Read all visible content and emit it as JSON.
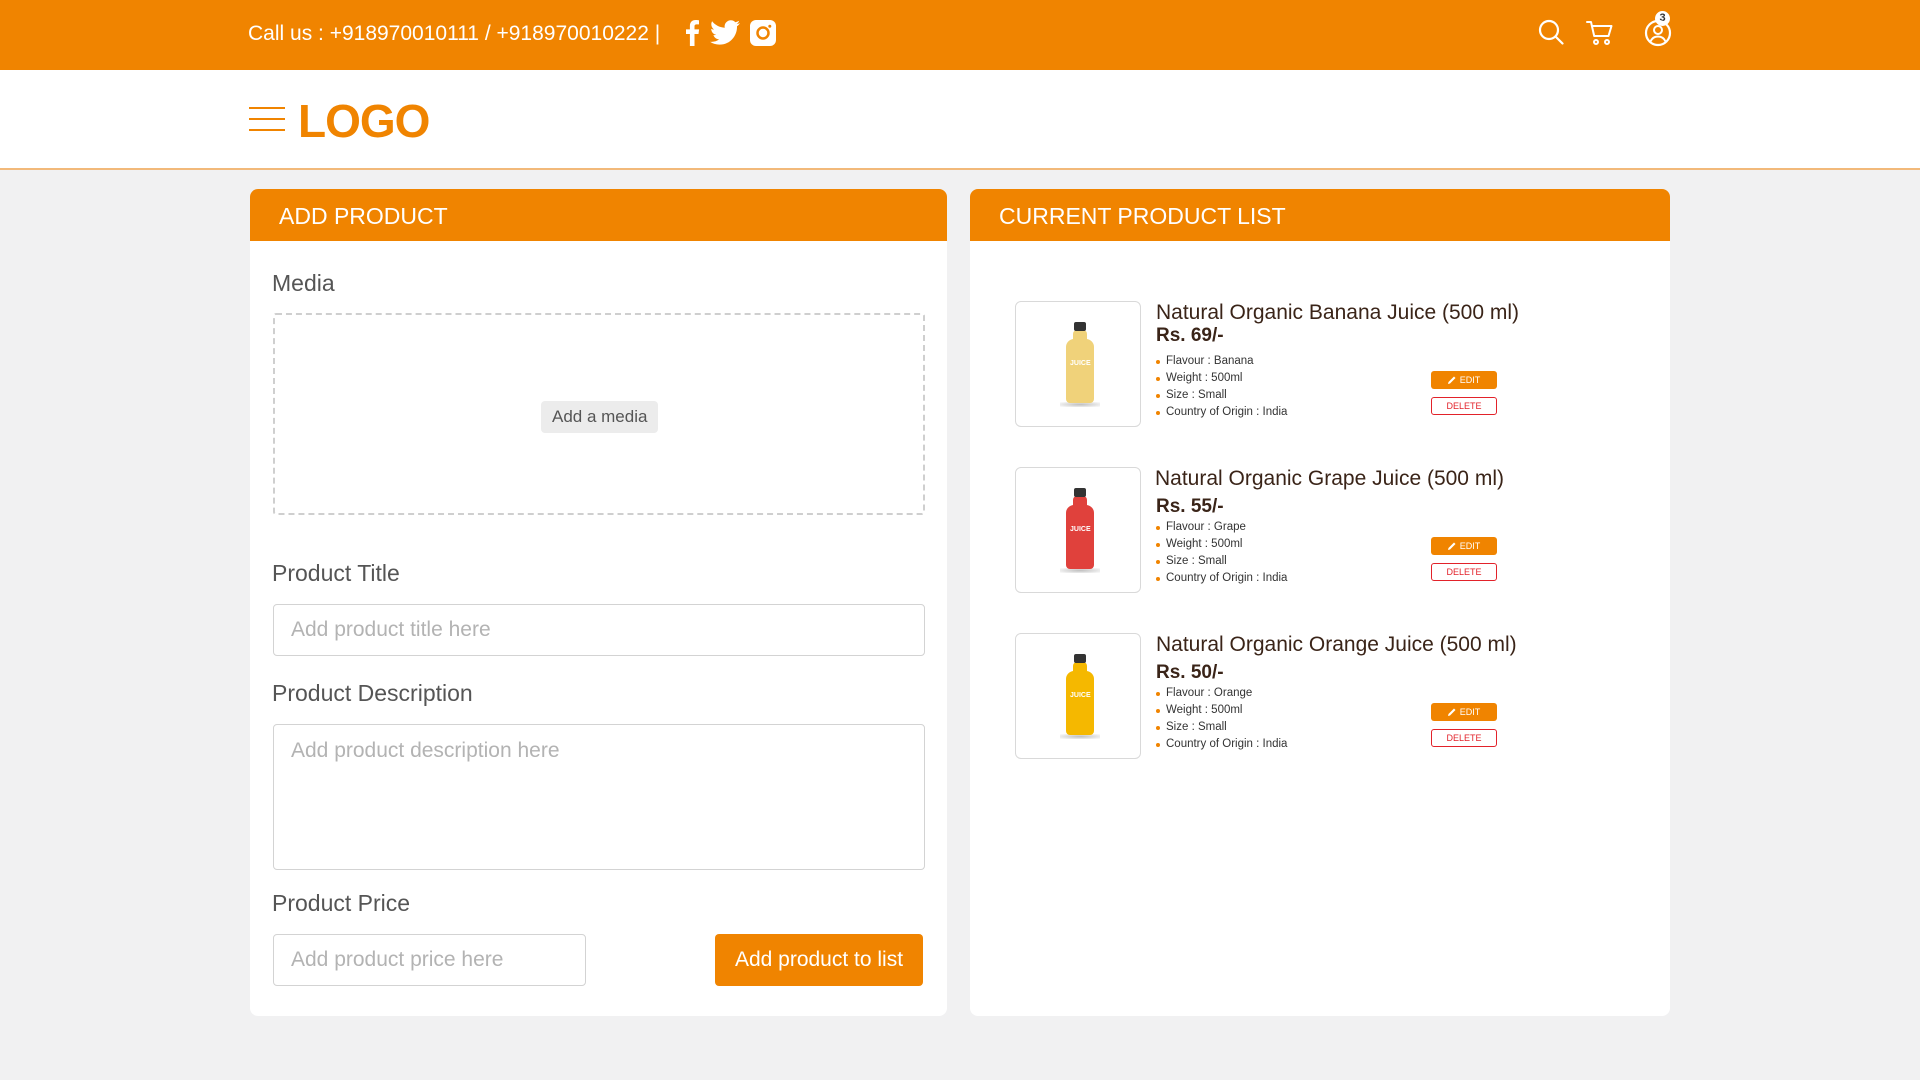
{
  "topbar": {
    "call_text": "Call us : +918970010111 / +918970010222  |",
    "cart_count": "3",
    "social_icons": [
      "facebook-icon",
      "twitter-icon",
      "instagram-icon"
    ],
    "right_icons": [
      "search-icon",
      "cart-icon",
      "user-icon"
    ]
  },
  "header": {
    "logo": "LOGO"
  },
  "add_product": {
    "heading": "ADD PRODUCT",
    "media_label": "Media",
    "media_button": "Add a media",
    "title_label": "Product Title",
    "title_placeholder": "Add product title here",
    "description_label": "Product Description",
    "description_placeholder": "Add product description here",
    "price_label": "Product Price",
    "price_placeholder": "Add product price here",
    "submit_label": "Add product to list"
  },
  "product_list": {
    "heading": "CURRENT PRODUCT LIST",
    "edit_label": "EDIT",
    "delete_label": "DELETE",
    "bottle_label": "JUICE",
    "items": [
      {
        "title": "Natural Organic Banana Juice (500 ml)",
        "price": "Rs. 69/-",
        "specs": [
          "Flavour : Banana",
          "Weight : 500ml",
          "Size : Small",
          "Country of Origin : India"
        ],
        "color": "#f0d27a"
      },
      {
        "title": "Natural Organic Grape Juice (500 ml)",
        "price": "Rs. 55/-",
        "specs": [
          "Flavour : Grape",
          "Weight : 500ml",
          "Size : Small",
          "Country of Origin : India"
        ],
        "color": "#e0413c"
      },
      {
        "title": "Natural Organic Orange Juice (500 ml)",
        "price": "Rs. 50/-",
        "specs": [
          "Flavour : Orange",
          "Weight : 500ml",
          "Size : Small",
          "Country of Origin : India"
        ],
        "color": "#f5b800"
      }
    ]
  },
  "colors": {
    "accent": "#f08400",
    "danger": "#e2222a",
    "background": "#f1f1f2"
  }
}
